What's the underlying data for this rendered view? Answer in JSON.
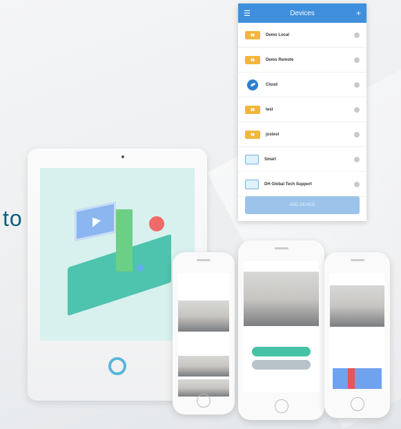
{
  "headline": {
    "text": "to"
  },
  "devices_screen": {
    "title": "Devices",
    "menu_icon": "menu-icon",
    "add_icon": "plus-icon",
    "items": [
      {
        "name": "Demo Local",
        "icon": "camera-tag-icon"
      },
      {
        "name": "Demo Remote",
        "icon": "camera-tag-icon"
      },
      {
        "name": "Cloud",
        "icon": "cloud-icon"
      },
      {
        "name": "test",
        "icon": "camera-tag-icon"
      },
      {
        "name": "justest",
        "icon": "camera-tag-icon"
      },
      {
        "name": "Smart",
        "icon": "camera-icon"
      },
      {
        "name": "DH Global Tech Support",
        "icon": "camera-icon"
      }
    ],
    "add_button": "ADD DEVICE"
  },
  "colors": {
    "header": "#3f8fdc",
    "headline": "#0d5d78",
    "accent_green": "#46c2a6"
  }
}
